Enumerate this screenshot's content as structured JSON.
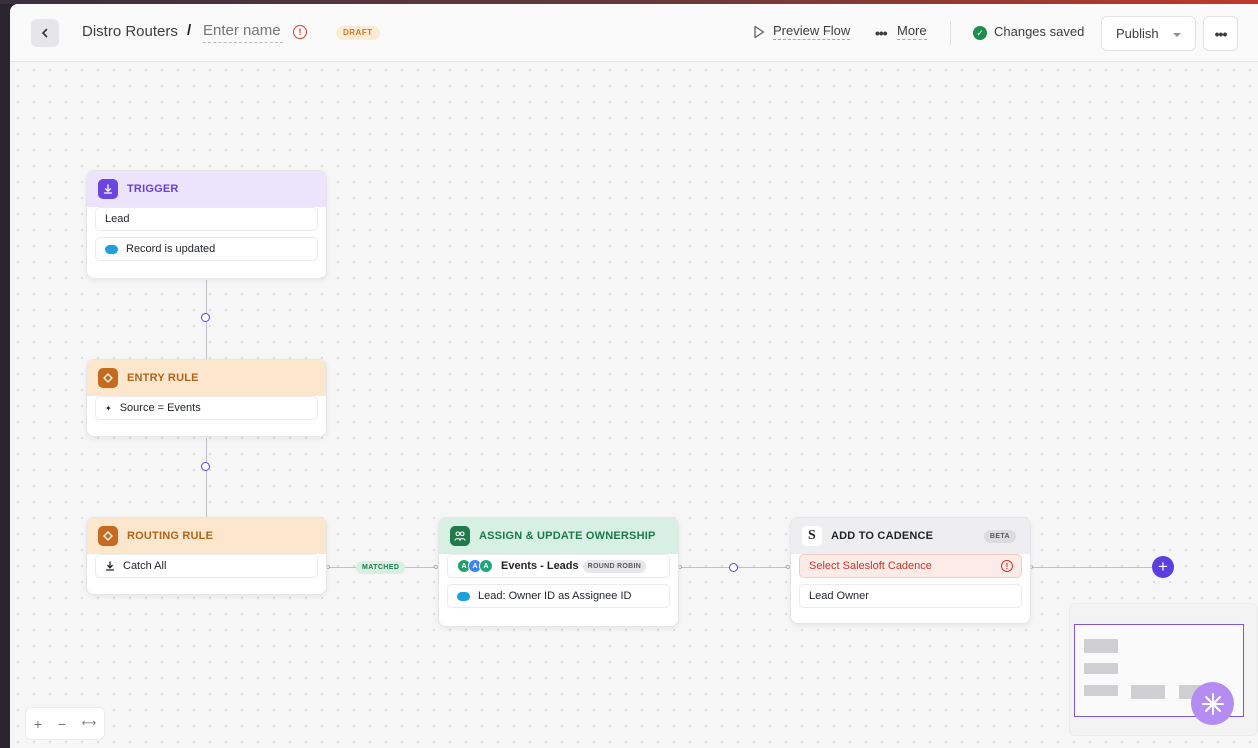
{
  "header": {
    "breadcrumb": "Distro Routers",
    "separator": "/",
    "name_placeholder": "Enter name",
    "status_badge": "DRAFT",
    "preview_label": "Preview Flow",
    "more_label": "More",
    "saved_label": "Changes saved",
    "publish_label": "Publish"
  },
  "nodes": {
    "trigger": {
      "title": "TRIGGER",
      "rows": [
        "Lead",
        "Record is updated"
      ]
    },
    "entry_rule": {
      "title": "ENTRY RULE",
      "rows": [
        "Source = Events"
      ]
    },
    "routing_rule": {
      "title": "ROUTING RULE",
      "rows": [
        "Catch All"
      ]
    },
    "assign": {
      "title": "ASSIGN & UPDATE OWNERSHIP",
      "event_label": "Events - Leads",
      "event_badge": "ROUND ROBIN",
      "avatars": [
        "A",
        "A",
        "A"
      ],
      "owner_row": "Lead: Owner ID as Assignee ID"
    },
    "cadence": {
      "title": "ADD TO CADENCE",
      "badge": "BETA",
      "error_row": "Select Salesloft Cadence",
      "owner_row": "Lead Owner"
    }
  },
  "connector": {
    "matched_label": "MATCHED"
  },
  "colors": {
    "accent": "#5b3fe0",
    "trigger": "#6a45e0",
    "rule": "#c56a1e",
    "assign": "#1f7a4c",
    "error": "#c9352a",
    "saved": "#1e8e4e"
  },
  "icons": {
    "back": "chevron-left-icon",
    "warning": "alert-circle-icon",
    "preview": "play-icon",
    "more": "dots-horizontal-icon",
    "saved": "check-circle-icon",
    "add": "plus-icon",
    "ai": "sparkle-icon"
  }
}
